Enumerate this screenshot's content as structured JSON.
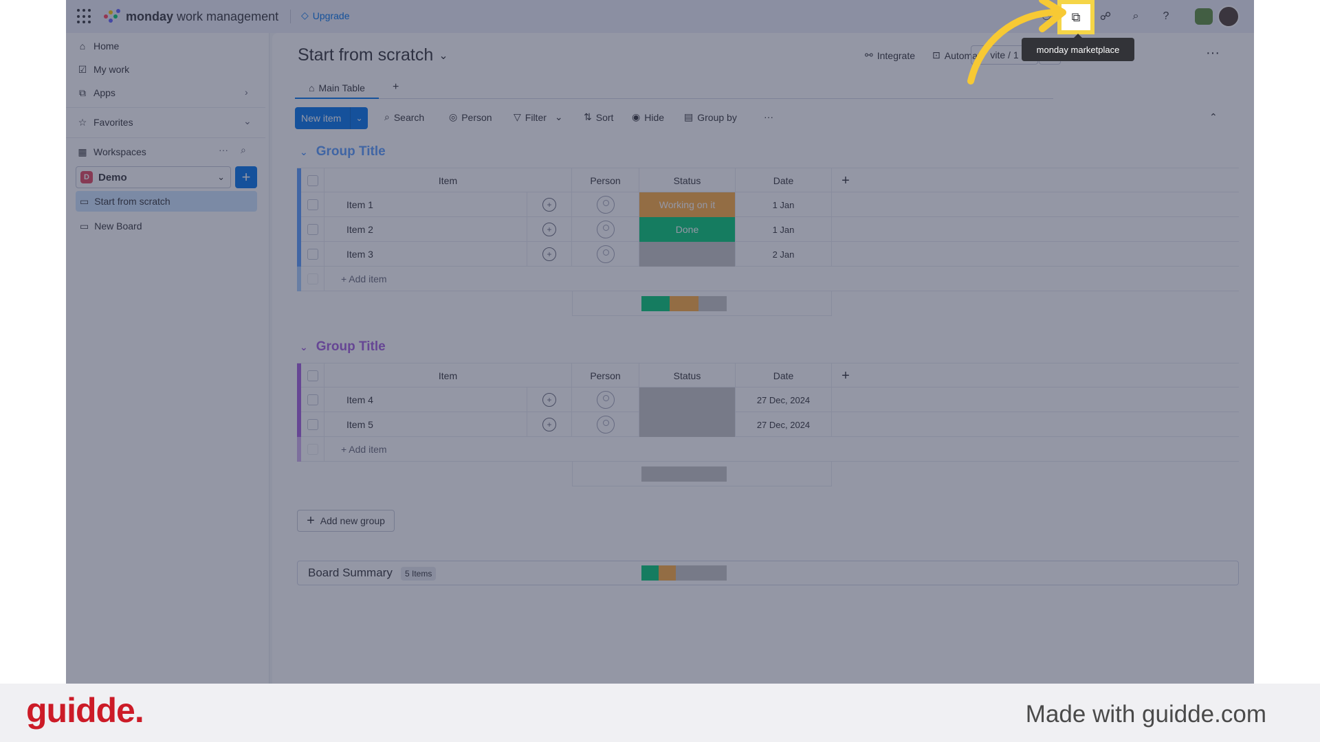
{
  "topbar": {
    "brand_bold": "monday",
    "brand_rest": " work management",
    "upgrade_label": "Upgrade",
    "tooltip": "monday marketplace"
  },
  "sidebar": {
    "nav": [
      {
        "label": "Home",
        "icon": "home-icon"
      },
      {
        "label": "My work",
        "icon": "my-work-icon"
      },
      {
        "label": "Apps",
        "icon": "apps-icon"
      }
    ],
    "favorites_label": "Favorites",
    "workspaces_label": "Workspaces",
    "workspace": {
      "badge": "D",
      "name": "Demo"
    },
    "boards": [
      {
        "label": "Start from scratch",
        "active": true
      },
      {
        "label": "New Board",
        "active": false
      }
    ]
  },
  "board": {
    "title": "Start from scratch",
    "integrate_label": "Integrate",
    "automate_label": "Automat",
    "invite_label": "vite / 1",
    "tab_label": "Main Table",
    "toolbar": {
      "new_item": "New item",
      "search": "Search",
      "person": "Person",
      "filter": "Filter",
      "sort": "Sort",
      "hide": "Hide",
      "group_by": "Group by"
    },
    "columns": {
      "item": "Item",
      "person": "Person",
      "status": "Status",
      "date": "Date"
    },
    "groups": [
      {
        "title": "Group Title",
        "color": "#579bfc",
        "rows": [
          {
            "item": "Item 1",
            "status": "Working on it",
            "status_color": "#fdab3d",
            "date": "1 Jan"
          },
          {
            "item": "Item 2",
            "status": "Done",
            "status_color": "#00c875",
            "date": "1 Jan"
          },
          {
            "item": "Item 3",
            "status": "",
            "status_color": "#c4c4c4",
            "date": "2 Jan"
          }
        ],
        "add_item": "+ Add item"
      },
      {
        "title": "Group Title",
        "color": "#a25ddc",
        "rows": [
          {
            "item": "Item 4",
            "status": "",
            "status_color": "#c4c4c4",
            "date": "27 Dec, 2024"
          },
          {
            "item": "Item 5",
            "status": "",
            "status_color": "#c4c4c4",
            "date": "27 Dec, 2024"
          }
        ],
        "add_item": "+ Add item"
      }
    ],
    "add_group": "Add new group",
    "summary_title": "Board Summary",
    "summary_count": "5 Items"
  },
  "footer": {
    "brand": "guidde.",
    "made_with": "Made with guidde.com"
  }
}
